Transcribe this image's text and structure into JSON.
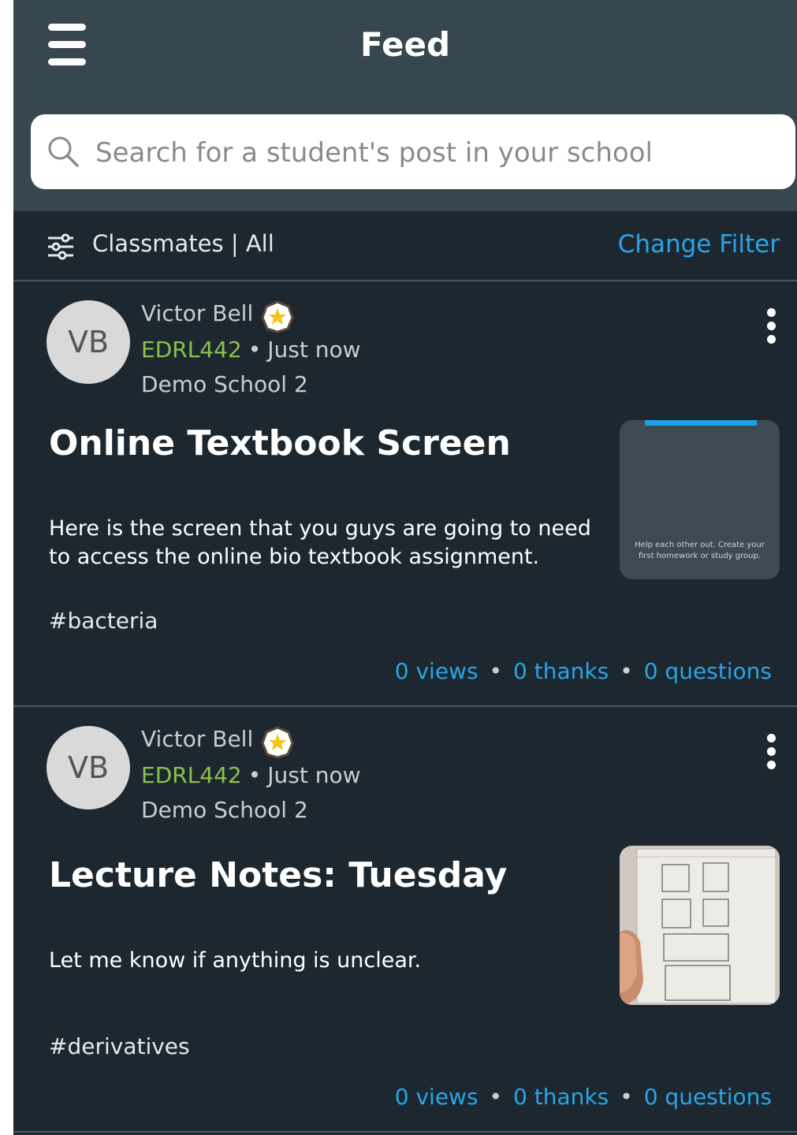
{
  "header": {
    "title": "Feed",
    "search_placeholder": "Search for a student's post in your school"
  },
  "filter": {
    "label": "Classmates | All",
    "change_label": "Change Filter"
  },
  "colors": {
    "header_bg": "#37474f",
    "feed_bg": "#1c2730",
    "accent_blue": "#2aa5e6",
    "course_green": "#8bc34a",
    "badge_gold": "#f5c518"
  },
  "posts": [
    {
      "author_initials": "VB",
      "author_name": "Victor Bell",
      "course": "EDRL442",
      "time": "Just now",
      "school": "Demo School 2",
      "title": "Online Textbook Screen",
      "body": "Here is the screen that you guys are going to need to access the online bio textbook assignment.",
      "hashtag": "#bacteria",
      "views": "0 views",
      "thanks": "0 thanks",
      "questions": "0 questions",
      "thumbnail_caption": "Help each other out. Create your first homework or study group."
    },
    {
      "author_initials": "VB",
      "author_name": "Victor Bell",
      "course": "EDRL442",
      "time": "Just now",
      "school": "Demo School 2",
      "title": "Lecture Notes: Tuesday",
      "body": "Let me know if anything is unclear.",
      "hashtag": "#derivatives",
      "views": "0 views",
      "thanks": "0 thanks",
      "questions": "0 questions"
    }
  ]
}
